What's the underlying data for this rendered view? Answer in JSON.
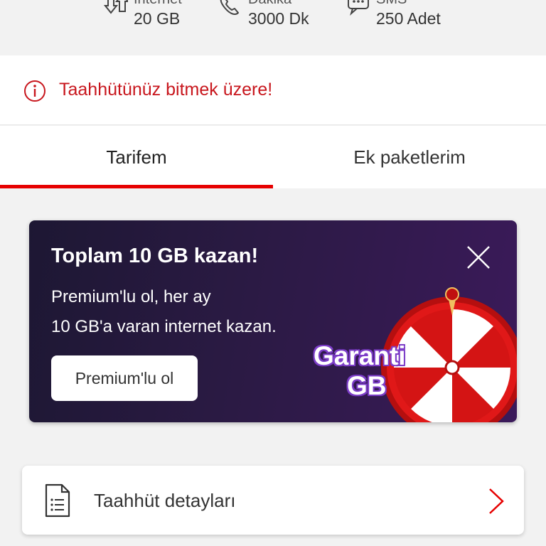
{
  "usage": [
    {
      "label": "İnternet",
      "value": "20 GB",
      "icon": "internet-icon"
    },
    {
      "label": "Dakika",
      "value": "3000 Dk",
      "icon": "phone-icon"
    },
    {
      "label": "SMS",
      "value": "250 Adet",
      "icon": "sms-icon"
    }
  ],
  "alert": {
    "text": "Taahhütünüz bitmek üzere!",
    "icon": "info-icon",
    "color": "#c8161d"
  },
  "tabs": [
    {
      "label": "Tarifem",
      "active": true
    },
    {
      "label": "Ek paketlerim",
      "active": false
    }
  ],
  "promo": {
    "title": "Toplam 10 GB kazan!",
    "line1": "Premium'lu ol, her ay",
    "line2": "10 GB'a varan internet kazan.",
    "cta": "Premium'lu ol",
    "badge_line1": "Garanti",
    "badge_line2": "GB"
  },
  "commitment_row": {
    "label": "Taahhüt detayları",
    "icon": "document-icon"
  },
  "colors": {
    "accent": "#e60000",
    "promo_bg": "#2b1a44"
  }
}
